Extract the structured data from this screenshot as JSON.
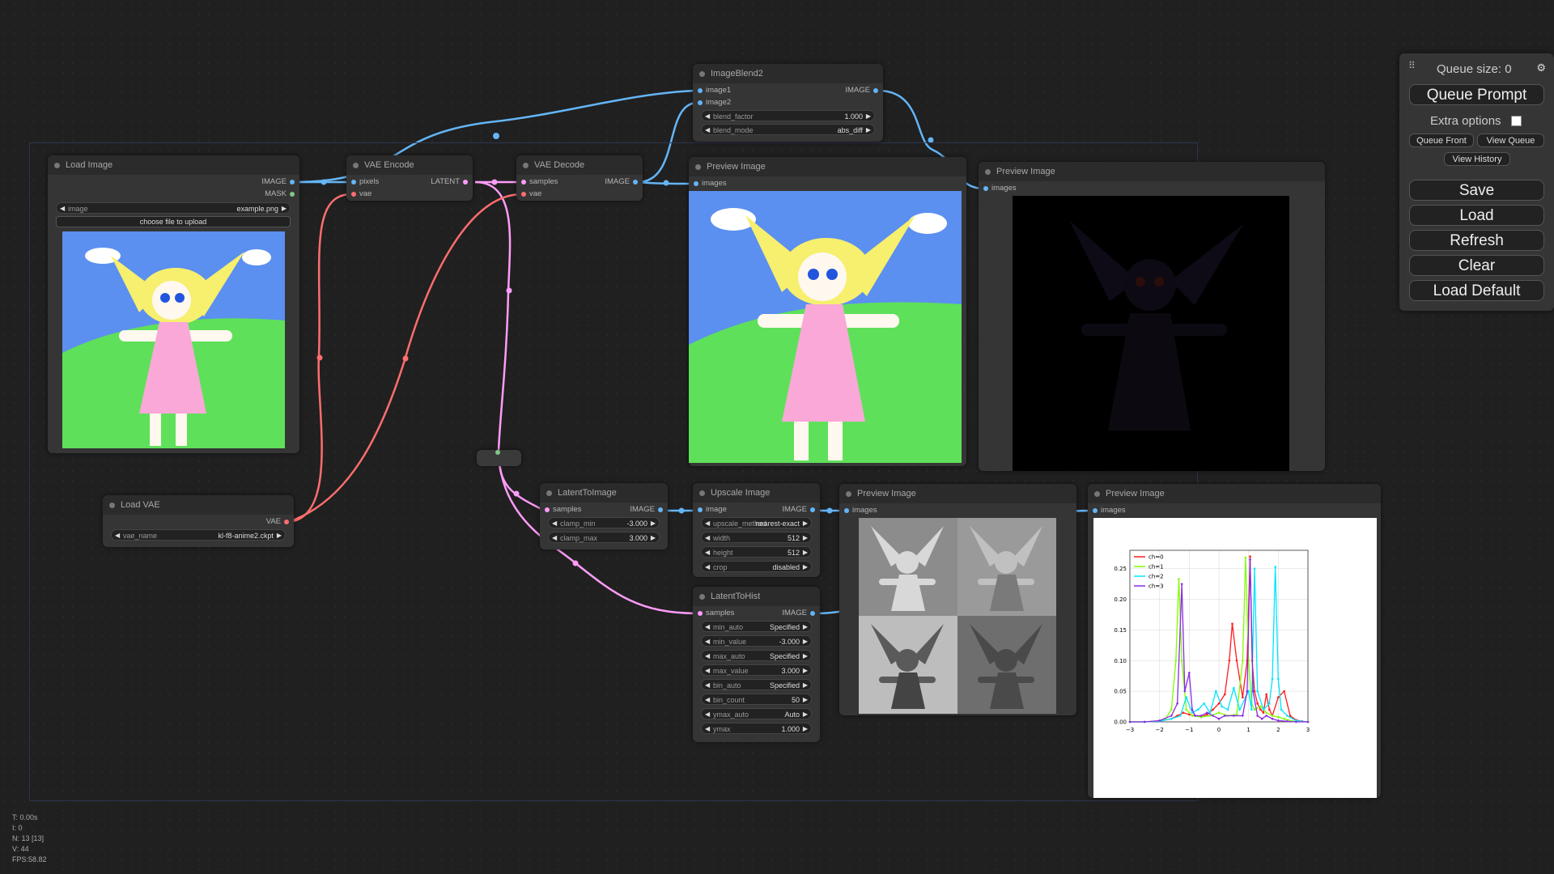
{
  "nodes": {
    "load_image": {
      "title": "Load Image",
      "outputs": [
        "IMAGE",
        "MASK"
      ],
      "widget_label": "image",
      "widget_value": "example.png",
      "upload_label": "choose file to upload"
    },
    "load_vae": {
      "title": "Load VAE",
      "output": "VAE",
      "widget_label": "vae_name",
      "widget_value": "kl-f8-anime2.ckpt"
    },
    "vae_encode": {
      "title": "VAE Encode",
      "inputs": [
        "pixels",
        "vae"
      ],
      "output": "LATENT"
    },
    "vae_decode": {
      "title": "VAE Decode",
      "inputs": [
        "samples",
        "vae"
      ],
      "output": "IMAGE"
    },
    "image_blend": {
      "title": "ImageBlend2",
      "inputs": [
        "image1",
        "image2"
      ],
      "output": "IMAGE",
      "widgets": [
        {
          "label": "blend_factor",
          "value": "1.000"
        },
        {
          "label": "blend_mode",
          "value": "abs_diff"
        }
      ]
    },
    "preview1": {
      "title": "Preview Image",
      "input": "images"
    },
    "preview2": {
      "title": "Preview Image",
      "input": "images"
    },
    "latent_to_image": {
      "title": "LatentToImage",
      "input": "samples",
      "output": "IMAGE",
      "widgets": [
        {
          "label": "clamp_min",
          "value": "-3.000"
        },
        {
          "label": "clamp_max",
          "value": "3.000"
        }
      ]
    },
    "upscale_image": {
      "title": "Upscale Image",
      "input": "image",
      "output": "IMAGE",
      "widgets": [
        {
          "label": "upscale_method",
          "value": "nearest-exact"
        },
        {
          "label": "width",
          "value": "512"
        },
        {
          "label": "height",
          "value": "512"
        },
        {
          "label": "crop",
          "value": "disabled"
        }
      ]
    },
    "latent_to_hist": {
      "title": "LatentToHist",
      "input": "samples",
      "output": "IMAGE",
      "widgets": [
        {
          "label": "min_auto",
          "value": "Specified"
        },
        {
          "label": "min_value",
          "value": "-3.000"
        },
        {
          "label": "max_auto",
          "value": "Specified"
        },
        {
          "label": "max_value",
          "value": "3.000"
        },
        {
          "label": "bin_auto",
          "value": "Specified"
        },
        {
          "label": "bin_count",
          "value": "50"
        },
        {
          "label": "ymax_auto",
          "value": "Auto"
        },
        {
          "label": "ymax",
          "value": "1.000"
        }
      ]
    },
    "preview3": {
      "title": "Preview Image",
      "input": "images"
    },
    "preview4": {
      "title": "Preview Image",
      "input": "images"
    }
  },
  "queue": {
    "size_label": "Queue size: 0",
    "queue_prompt": "Queue Prompt",
    "extra_options": "Extra options",
    "extra_checked": false,
    "queue_front": "Queue Front",
    "view_queue": "View Queue",
    "view_history": "View History",
    "save": "Save",
    "load": "Load",
    "refresh": "Refresh",
    "clear": "Clear",
    "load_default": "Load Default"
  },
  "stats": {
    "t": "T: 0.00s",
    "i": "I: 0",
    "n": "N: 13 [13]",
    "v": "V: 44",
    "fps": "FPS:58.82"
  },
  "colors": {
    "image_wire": "#64b5f6",
    "latent_wire": "#ff9cf9",
    "vae_wire": "#ff6e6e",
    "mask_wire": "#81c784"
  },
  "chart_data": {
    "type": "line",
    "x_ticks": [
      "−3",
      "−2",
      "−1",
      "0",
      "1",
      "2",
      "3"
    ],
    "y_ticks": [
      "0.00",
      "0.05",
      "0.10",
      "0.15",
      "0.20",
      "0.25"
    ],
    "xlim": [
      -3,
      3
    ],
    "ylim": [
      0,
      0.28
    ],
    "grid": true,
    "legend_position": "top-left",
    "series": [
      {
        "name": "ch=0",
        "color": "#ff1a1a",
        "x": [
          -3,
          -2.5,
          -2,
          -1.6,
          -1.4,
          -1.2,
          -1.0,
          -0.8,
          -0.6,
          -0.4,
          -0.2,
          0,
          0.2,
          0.35,
          0.45,
          0.6,
          0.8,
          0.95,
          1.05,
          1.12,
          1.2,
          1.3,
          1.4,
          1.5,
          1.6,
          1.7,
          1.8,
          2.0,
          2.2,
          2.4,
          2.6,
          2.8,
          3
        ],
        "y": [
          0,
          0,
          0.001,
          0.005,
          0.01,
          0.015,
          0.012,
          0.01,
          0.008,
          0.012,
          0.02,
          0.03,
          0.045,
          0.1,
          0.16,
          0.1,
          0.04,
          0.1,
          0.27,
          0.1,
          0.05,
          0.03,
          0.02,
          0.015,
          0.045,
          0.02,
          0.01,
          0.04,
          0.05,
          0.01,
          0.003,
          0.001,
          0
        ]
      },
      {
        "name": "ch=1",
        "color": "#7fff00",
        "x": [
          -3,
          -2.5,
          -2,
          -1.8,
          -1.6,
          -1.45,
          -1.35,
          -1.25,
          -1.1,
          -0.9,
          -0.6,
          -0.3,
          0,
          0.3,
          0.6,
          0.8,
          0.9,
          1.0,
          1.1,
          1.2,
          1.4,
          1.6,
          1.8,
          2.0,
          2.2,
          2.5,
          3
        ],
        "y": [
          0,
          0,
          0.002,
          0.005,
          0.02,
          0.1,
          0.233,
          0.1,
          0.02,
          0.01,
          0.008,
          0.01,
          0.015,
          0.01,
          0.012,
          0.1,
          0.268,
          0.1,
          0.03,
          0.02,
          0.025,
          0.015,
          0.01,
          0.008,
          0.005,
          0.001,
          0
        ]
      },
      {
        "name": "ch=2",
        "color": "#00e5ff",
        "x": [
          -3,
          -2.5,
          -2,
          -1.6,
          -1.3,
          -1.1,
          -0.9,
          -0.7,
          -0.5,
          -0.3,
          -0.1,
          0.1,
          0.3,
          0.5,
          0.7,
          0.9,
          1.0,
          1.1,
          1.2,
          1.3,
          1.5,
          1.7,
          1.8,
          1.9,
          2.0,
          2.1,
          2.3,
          2.6,
          3
        ],
        "y": [
          0,
          0,
          0.001,
          0.005,
          0.01,
          0.04,
          0.015,
          0.02,
          0.03,
          0.015,
          0.05,
          0.025,
          0.02,
          0.055,
          0.02,
          0.04,
          0.05,
          0.02,
          0.25,
          0.05,
          0.02,
          0.03,
          0.07,
          0.253,
          0.07,
          0.02,
          0.01,
          0.002,
          0
        ]
      },
      {
        "name": "ch=3",
        "color": "#8a2be2",
        "x": [
          -3,
          -2.5,
          -2,
          -1.6,
          -1.4,
          -1.25,
          -1.15,
          -1.0,
          -0.9,
          -0.8,
          -0.6,
          -0.4,
          -0.2,
          0,
          0.2,
          0.5,
          0.8,
          0.95,
          1.05,
          1.15,
          1.3,
          1.45,
          1.6,
          1.8,
          2.0,
          2.3,
          2.6,
          3
        ],
        "y": [
          0,
          0,
          0.002,
          0.01,
          0.03,
          0.225,
          0.05,
          0.08,
          0.02,
          0.01,
          0.01,
          0.015,
          0.01,
          0.005,
          0.01,
          0.01,
          0.01,
          0.05,
          0.265,
          0.05,
          0.01,
          0.005,
          0.01,
          0.005,
          0.002,
          0.001,
          0,
          0
        ]
      }
    ]
  }
}
